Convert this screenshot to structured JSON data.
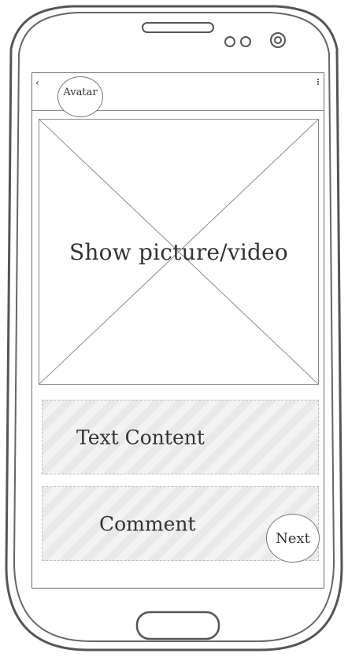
{
  "app": {
    "back_icon": "‹",
    "avatar_label": "Avatar",
    "more_icon": "overflow-menu"
  },
  "media": {
    "label": "Show picture/video"
  },
  "content": {
    "text_label": "Text Content",
    "comment_label": "Comment"
  },
  "actions": {
    "next_label": "Next"
  },
  "colors": {
    "phone_outline": "#555555",
    "placeholder_fill": "#f3f3f3",
    "stroke": "#777777"
  }
}
